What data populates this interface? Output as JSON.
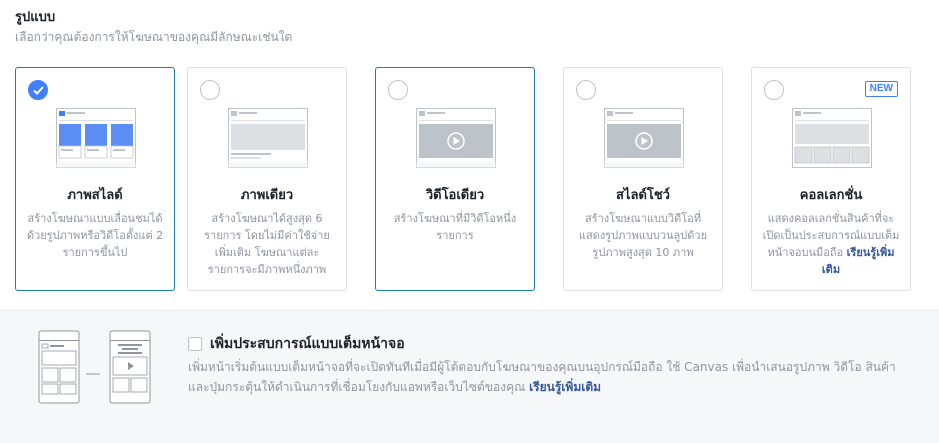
{
  "header": {
    "title": "รูปแบบ",
    "subtitle": "เลือกว่าคุณต้องการให้โฆษณาของคุณมีลักษณะเช่นใด"
  },
  "formats": [
    {
      "name": "ภาพสไลด์",
      "description": "สร้างโฆษณาแบบเลื่อนชมได้ด้วยรูปภาพหรือวิดีโอตั้งแต่ 2 รายการขึ้นไป",
      "selected": true,
      "icon": "carousel-icon"
    },
    {
      "name": "ภาพเดียว",
      "description": "สร้างโฆษณาได้สูงสุด 6 รายการ โดยไม่มีค่าใช้จ่ายเพิ่มเติม โฆษณาแต่ละรายการจะมีภาพหนึ่งภาพ",
      "selected": false,
      "icon": "single-image-icon"
    },
    {
      "name": "วิดีโอเดียว",
      "description": "สร้างโฆษณาที่มีวิดีโอหนึ่งรายการ",
      "selected": false,
      "icon": "single-video-icon"
    },
    {
      "name": "สไลด์โชว์",
      "description": "สร้างโฆษณาแบบวิดีโอที่แสดงรูปภาพแบบวนลูปด้วยรูปภาพสูงสุด 10 ภาพ",
      "selected": false,
      "icon": "slideshow-icon"
    },
    {
      "name": "คอลเลกชั่น",
      "description": "แสดงคอลเลกชั่นสินค้าที่จะเปิดเป็นประสบการณ์แบบเต็มหน้าจอบนมือถือ",
      "learn_more": "เรียนรู้เพิ่มเติม",
      "badge": "NEW",
      "selected": false,
      "icon": "collection-icon"
    }
  ],
  "fullscreen": {
    "label": "เพิ่มประสบการณ์แบบเต็มหน้าจอ",
    "checked": false,
    "description": "เพิ่มหน้าเริ่มต้นแบบเต็มหน้าจอที่จะเปิดทันทีเมื่อมีผู้โต้ตอบกับโฆษณาของคุณบนอุปกรณ์มือถือ ใช้ Canvas เพื่อนำเสนอรูปภาพ วิดีโอ สินค้า และปุ่มกระตุ้นให้ดำเนินการที่เชื่อมโยงกับแอพหรือเว็บไซต์ของคุณ",
    "learn_more": "เรียนรู้เพิ่มเติม"
  },
  "colors": {
    "accent": "#4080ff",
    "selected_border": "#1d7fa1",
    "link": "#365899",
    "muted_text": "#90949c"
  }
}
